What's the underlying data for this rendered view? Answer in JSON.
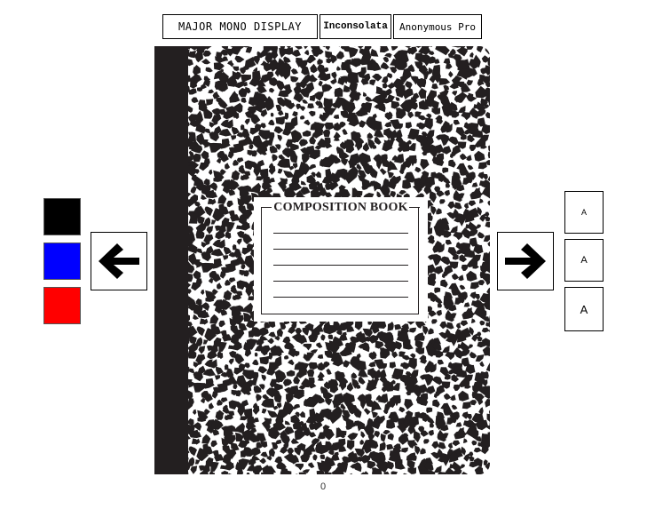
{
  "font_tabs": [
    {
      "label": "MAJOR MONO DISPLAY"
    },
    {
      "label": "Inconsolata"
    },
    {
      "label": "Anonymous Pro"
    }
  ],
  "book": {
    "label_title": "COMPOSITION BOOK",
    "cover_color": "#231f20",
    "pattern_color": "#ffffff"
  },
  "navigation": {
    "prev_icon": "arrow-left-icon",
    "next_icon": "arrow-right-icon"
  },
  "colors": [
    {
      "name": "black",
      "hex": "#000000"
    },
    {
      "name": "blue",
      "hex": "#0000ff"
    },
    {
      "name": "red",
      "hex": "#ff0000"
    }
  ],
  "sizes": [
    {
      "label": "A"
    },
    {
      "label": "A"
    },
    {
      "label": "A"
    }
  ],
  "page_counter": "0"
}
